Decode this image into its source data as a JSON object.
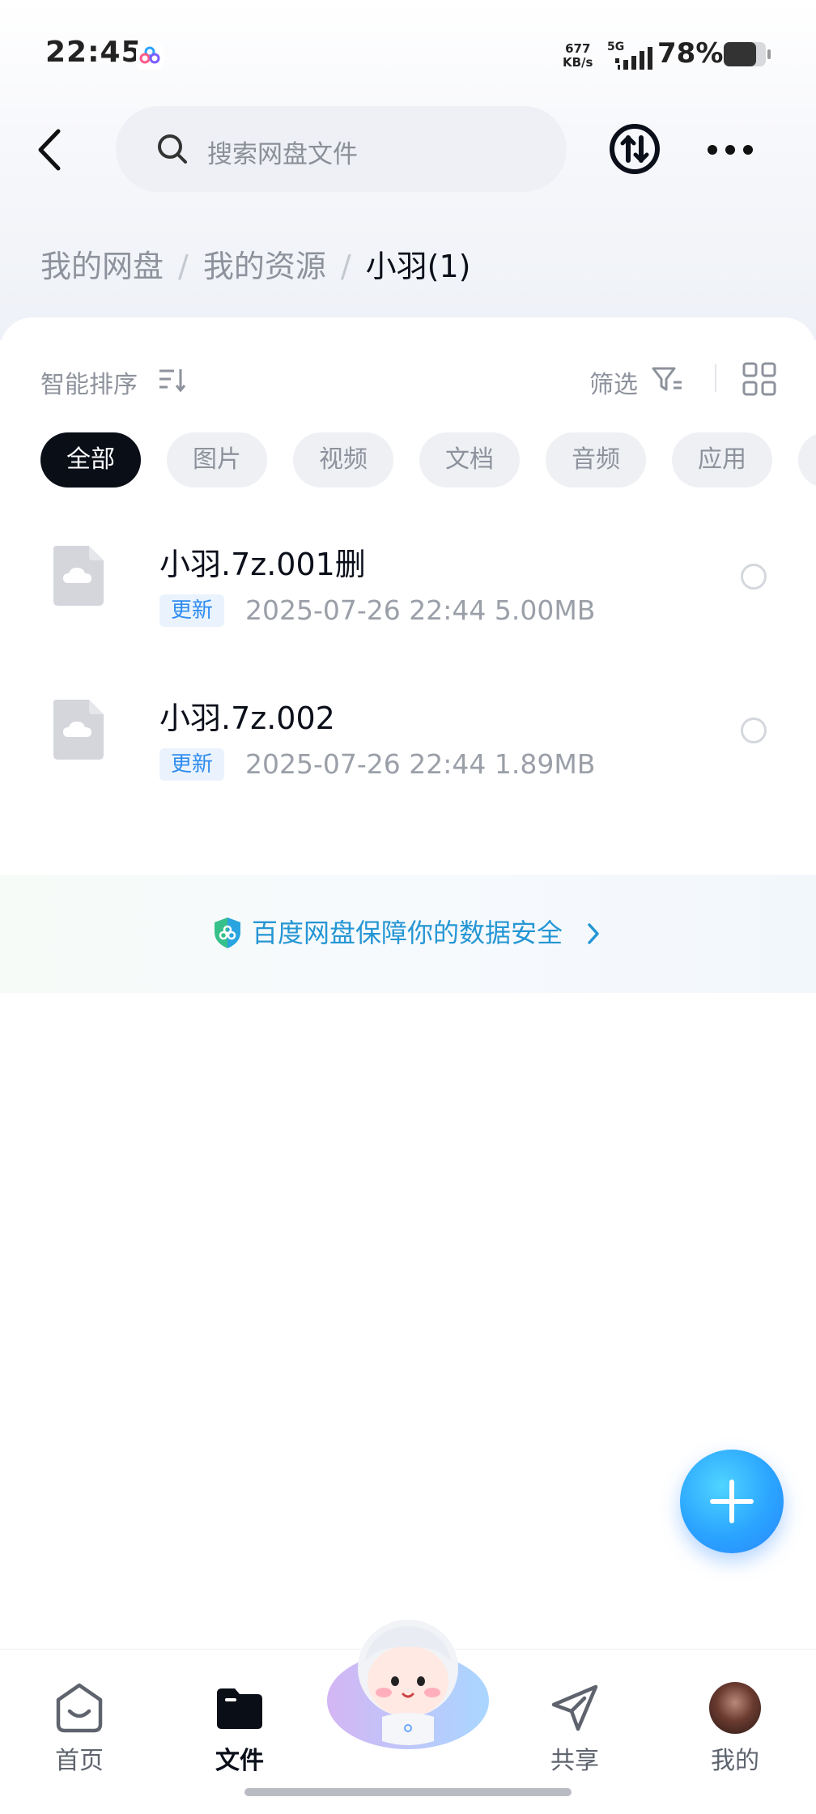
{
  "status_bar": {
    "time": "22:45",
    "net_speed_value": "677",
    "net_speed_unit": "KB/s",
    "network": "5G",
    "battery": "78%"
  },
  "search": {
    "placeholder": "搜索网盘文件"
  },
  "breadcrumb": {
    "items": [
      "我的网盘",
      "我的资源"
    ],
    "current": "小羽(1)",
    "separator": "/"
  },
  "toolbar": {
    "sort_label": "智能排序",
    "filter_label": "筛选"
  },
  "chips": {
    "items": [
      "全部",
      "图片",
      "视频",
      "文档",
      "音频",
      "应用"
    ],
    "selected": "全部"
  },
  "files": [
    {
      "name": "小羽.7z.001删",
      "badge": "更新",
      "meta": "2025-07-26  22:44  5.00MB",
      "icon": "cloud-file-icon"
    },
    {
      "name": "小羽.7z.002",
      "badge": "更新",
      "meta": "2025-07-26  22:44  1.89MB",
      "icon": "cloud-file-icon"
    }
  ],
  "security_banner": {
    "text": "百度网盘保障你的数据安全",
    "icon": "shield-icon"
  },
  "bottom_nav": {
    "items": [
      {
        "label": "首页",
        "icon": "home-icon"
      },
      {
        "label": "文件",
        "icon": "folder-icon",
        "active": true
      },
      {
        "label": "共享",
        "icon": "send-icon"
      },
      {
        "label": "我的",
        "icon": "avatar"
      }
    ]
  },
  "colors": {
    "accent_blue": "#2f8cf0",
    "chip_active": "#0a0e17",
    "link_teal": "#2596d4"
  }
}
